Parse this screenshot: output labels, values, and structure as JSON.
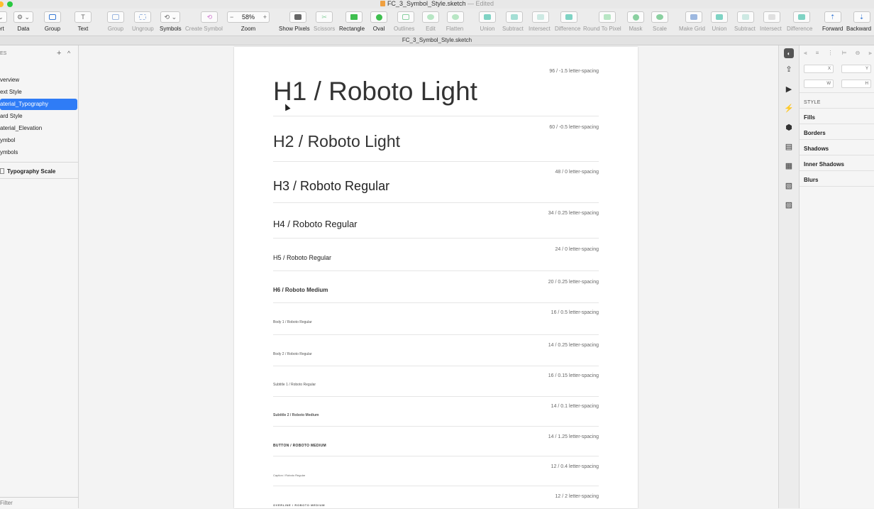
{
  "window": {
    "title": "FC_3_Symbol_Style.sketch",
    "edited": "— Edited",
    "tab_title": "FC_3_Symbol_Style.sketch",
    "traffic_colors": [
      "#ff5f57",
      "#ffbd2e",
      "#28c840"
    ]
  },
  "toolbar": {
    "insert": "ert",
    "data": "Data",
    "group": "Group",
    "text": "Text",
    "group2": "Group",
    "ungroup": "Ungroup",
    "symbols": "Symbols",
    "create_symbol": "Create Symbol",
    "zoom_value": "58%",
    "zoom_minus": "−",
    "zoom_plus": "+",
    "zoom": "Zoom",
    "show_pixels": "Show Pixels",
    "scissors": "Scissors",
    "rectangle": "Rectangle",
    "oval": "Oval",
    "outlines": "Outlines",
    "edit": "Edit",
    "flatten": "Flatten",
    "union": "Union",
    "subtract": "Subtract",
    "intersect": "Intersect",
    "difference": "Difference",
    "round_to_pixel": "Round To Pixel",
    "mask": "Mask",
    "scale": "Scale",
    "make_grid": "Make Grid",
    "union2": "Union",
    "subtract2": "Subtract",
    "intersect2": "Intersect",
    "difference2": "Difference",
    "forward": "Forward",
    "backward": "Backward"
  },
  "sidebar": {
    "pages_label": "ES",
    "pages": [
      {
        "label": "verview"
      },
      {
        "label": "ext Style"
      },
      {
        "label": "aterial_Typography",
        "selected": true
      },
      {
        "label": "ard Style"
      },
      {
        "label": "aterial_Elevation"
      },
      {
        "label": "ymbol"
      },
      {
        "label": "ymbols"
      }
    ],
    "layer": "Typography Scale",
    "filter": "Filter"
  },
  "artboard": {
    "rows": [
      {
        "sample": "H1 / Roboto Light",
        "spec": "96 / -1.5 letter-spacing"
      },
      {
        "sample": "H2 / Roboto Light",
        "spec": "60 / -0.5 letter-spacing"
      },
      {
        "sample": "H3 / Roboto Regular",
        "spec": "48 / 0 letter-spacing"
      },
      {
        "sample": "H4 / Roboto Regular",
        "spec": "34 / 0.25 letter-spacing"
      },
      {
        "sample": "H5 / Roboto Regular",
        "spec": "24 / 0 letter-spacing"
      },
      {
        "sample": "H6 / Roboto Medium",
        "spec": "20 / 0.25 letter-spacing"
      },
      {
        "sample": "Body 1 / Roboto Regular",
        "spec": "16 / 0.5 letter-spacing"
      },
      {
        "sample": "Body 2 / Roboto Regular",
        "spec": "14 / 0.25 letter-spacing"
      },
      {
        "sample": "Subtitle 1 / Roboto Regular",
        "spec": "16 / 0.15 letter-spacing"
      },
      {
        "sample": "Subtitle 2 / Roboto Medium",
        "spec": "14 / 0.1 letter-spacing"
      },
      {
        "sample": "BUTTON / ROBOTO MEDIUM",
        "spec": "14 / 1.25 letter-spacing"
      },
      {
        "sample": "Caption / Roboto Regular",
        "spec": "12 / 0.4 letter-spacing"
      },
      {
        "sample": "OVERLINE / ROBOTO MEDIUM",
        "spec": "12 / 2 letter-spacing"
      }
    ]
  },
  "inspector": {
    "x_label": "X",
    "y_label": "Y",
    "w_label": "W",
    "h_label": "H",
    "style_heading": "STYLE",
    "fills": "Fills",
    "borders": "Borders",
    "shadows": "Shadows",
    "inner_shadows": "Inner Shadows",
    "blurs": "Blurs"
  },
  "colors": {
    "accent": "#2f7cf6",
    "shape_green": "#3fbf4f",
    "boolean_teal": "#7fd3c4"
  }
}
